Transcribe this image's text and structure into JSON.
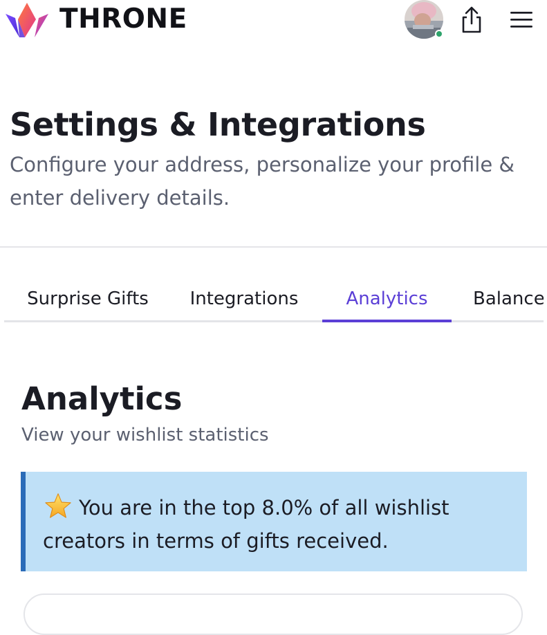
{
  "header": {
    "brand": "THRONE",
    "logo_icon": "crown-logo-icon",
    "avatar_icon": "user-avatar",
    "share_icon": "share-icon",
    "menu_icon": "hamburger-menu-icon",
    "colors": {
      "status_online": "#2ea36b"
    }
  },
  "page": {
    "title": "Settings & Integrations",
    "subtitle": "Configure your address, personalize your profile & enter delivery details."
  },
  "tabs": {
    "items": [
      {
        "label": "Surprise Gifts",
        "active": false
      },
      {
        "label": "Integrations",
        "active": false
      },
      {
        "label": "Analytics",
        "active": true
      },
      {
        "label": "Balance",
        "active": false
      }
    ],
    "colors": {
      "active": "#5b3fd6"
    }
  },
  "analytics": {
    "title": "Analytics",
    "subtitle": "View your wishlist statistics",
    "callout": {
      "icon": "star-icon",
      "text": "You are in the top 8.0% of all wishlist creators in terms of gifts received.",
      "colors": {
        "background": "#bfe0f7",
        "border": "#2b6cb8"
      }
    }
  }
}
